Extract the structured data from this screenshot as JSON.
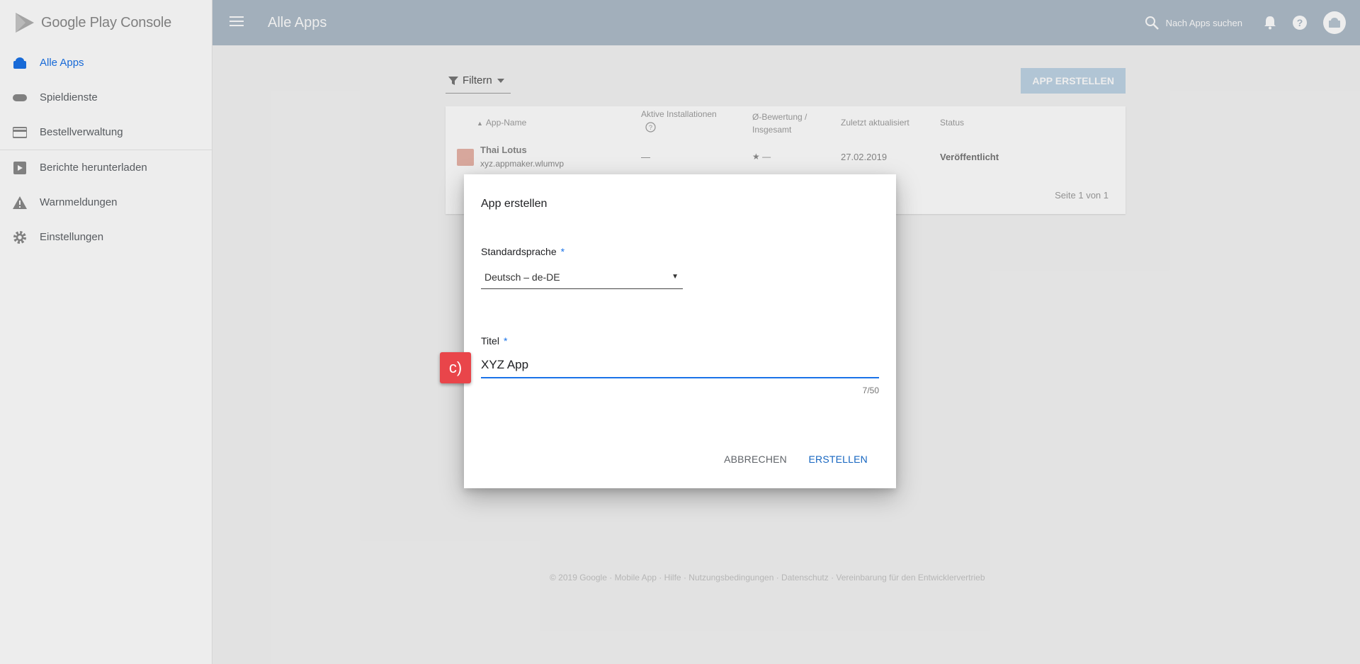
{
  "sidebar": {
    "brand": "Google Play Console",
    "items": [
      {
        "label": "Alle Apps",
        "icon": "android-apps-icon"
      },
      {
        "label": "Spieldienste",
        "icon": "gamepad-icon"
      },
      {
        "label": "Bestellverwaltung",
        "icon": "credit-card-icon"
      },
      {
        "label": "Berichte herunterladen",
        "icon": "download-report-icon"
      },
      {
        "label": "Warnmeldungen",
        "icon": "warning-icon"
      },
      {
        "label": "Einstellungen",
        "icon": "gear-icon"
      }
    ]
  },
  "header": {
    "title": "Alle Apps",
    "search_placeholder": "Nach Apps suchen"
  },
  "toolbar": {
    "filter_label": "Filtern",
    "create_button": "APP ERSTELLEN"
  },
  "table": {
    "columns": [
      "App-Name",
      "Aktive Installationen",
      "Ø-Bewertung / Insgesamt",
      "Zuletzt aktualisiert",
      "Status"
    ],
    "rows": [
      {
        "name": "Thai Lotus",
        "package": "xyz.appmaker.wlumvp",
        "installs": "—",
        "rating": "★ —",
        "updated": "27.02.2019",
        "status": "Veröffentlicht"
      }
    ],
    "pager": "Seite 1 von 1"
  },
  "footer": {
    "text": "© 2019 Google · Mobile App · Hilfe · Nutzungsbedingungen · Datenschutz · Vereinbarung für den Entwicklervertrieb"
  },
  "dialog": {
    "title": "App erstellen",
    "language_label": "Standardsprache",
    "required_mark": "*",
    "language_value": "Deutsch – de-DE",
    "title_label": "Titel",
    "title_value": "XYZ App",
    "counter": "7/50",
    "cancel": "ABBRECHEN",
    "confirm": "ERSTELLEN"
  },
  "marker": {
    "label": "c)"
  },
  "colors": {
    "accent": "#1a73e8",
    "topbar": "#afbdca",
    "marker": "#e9454a"
  }
}
